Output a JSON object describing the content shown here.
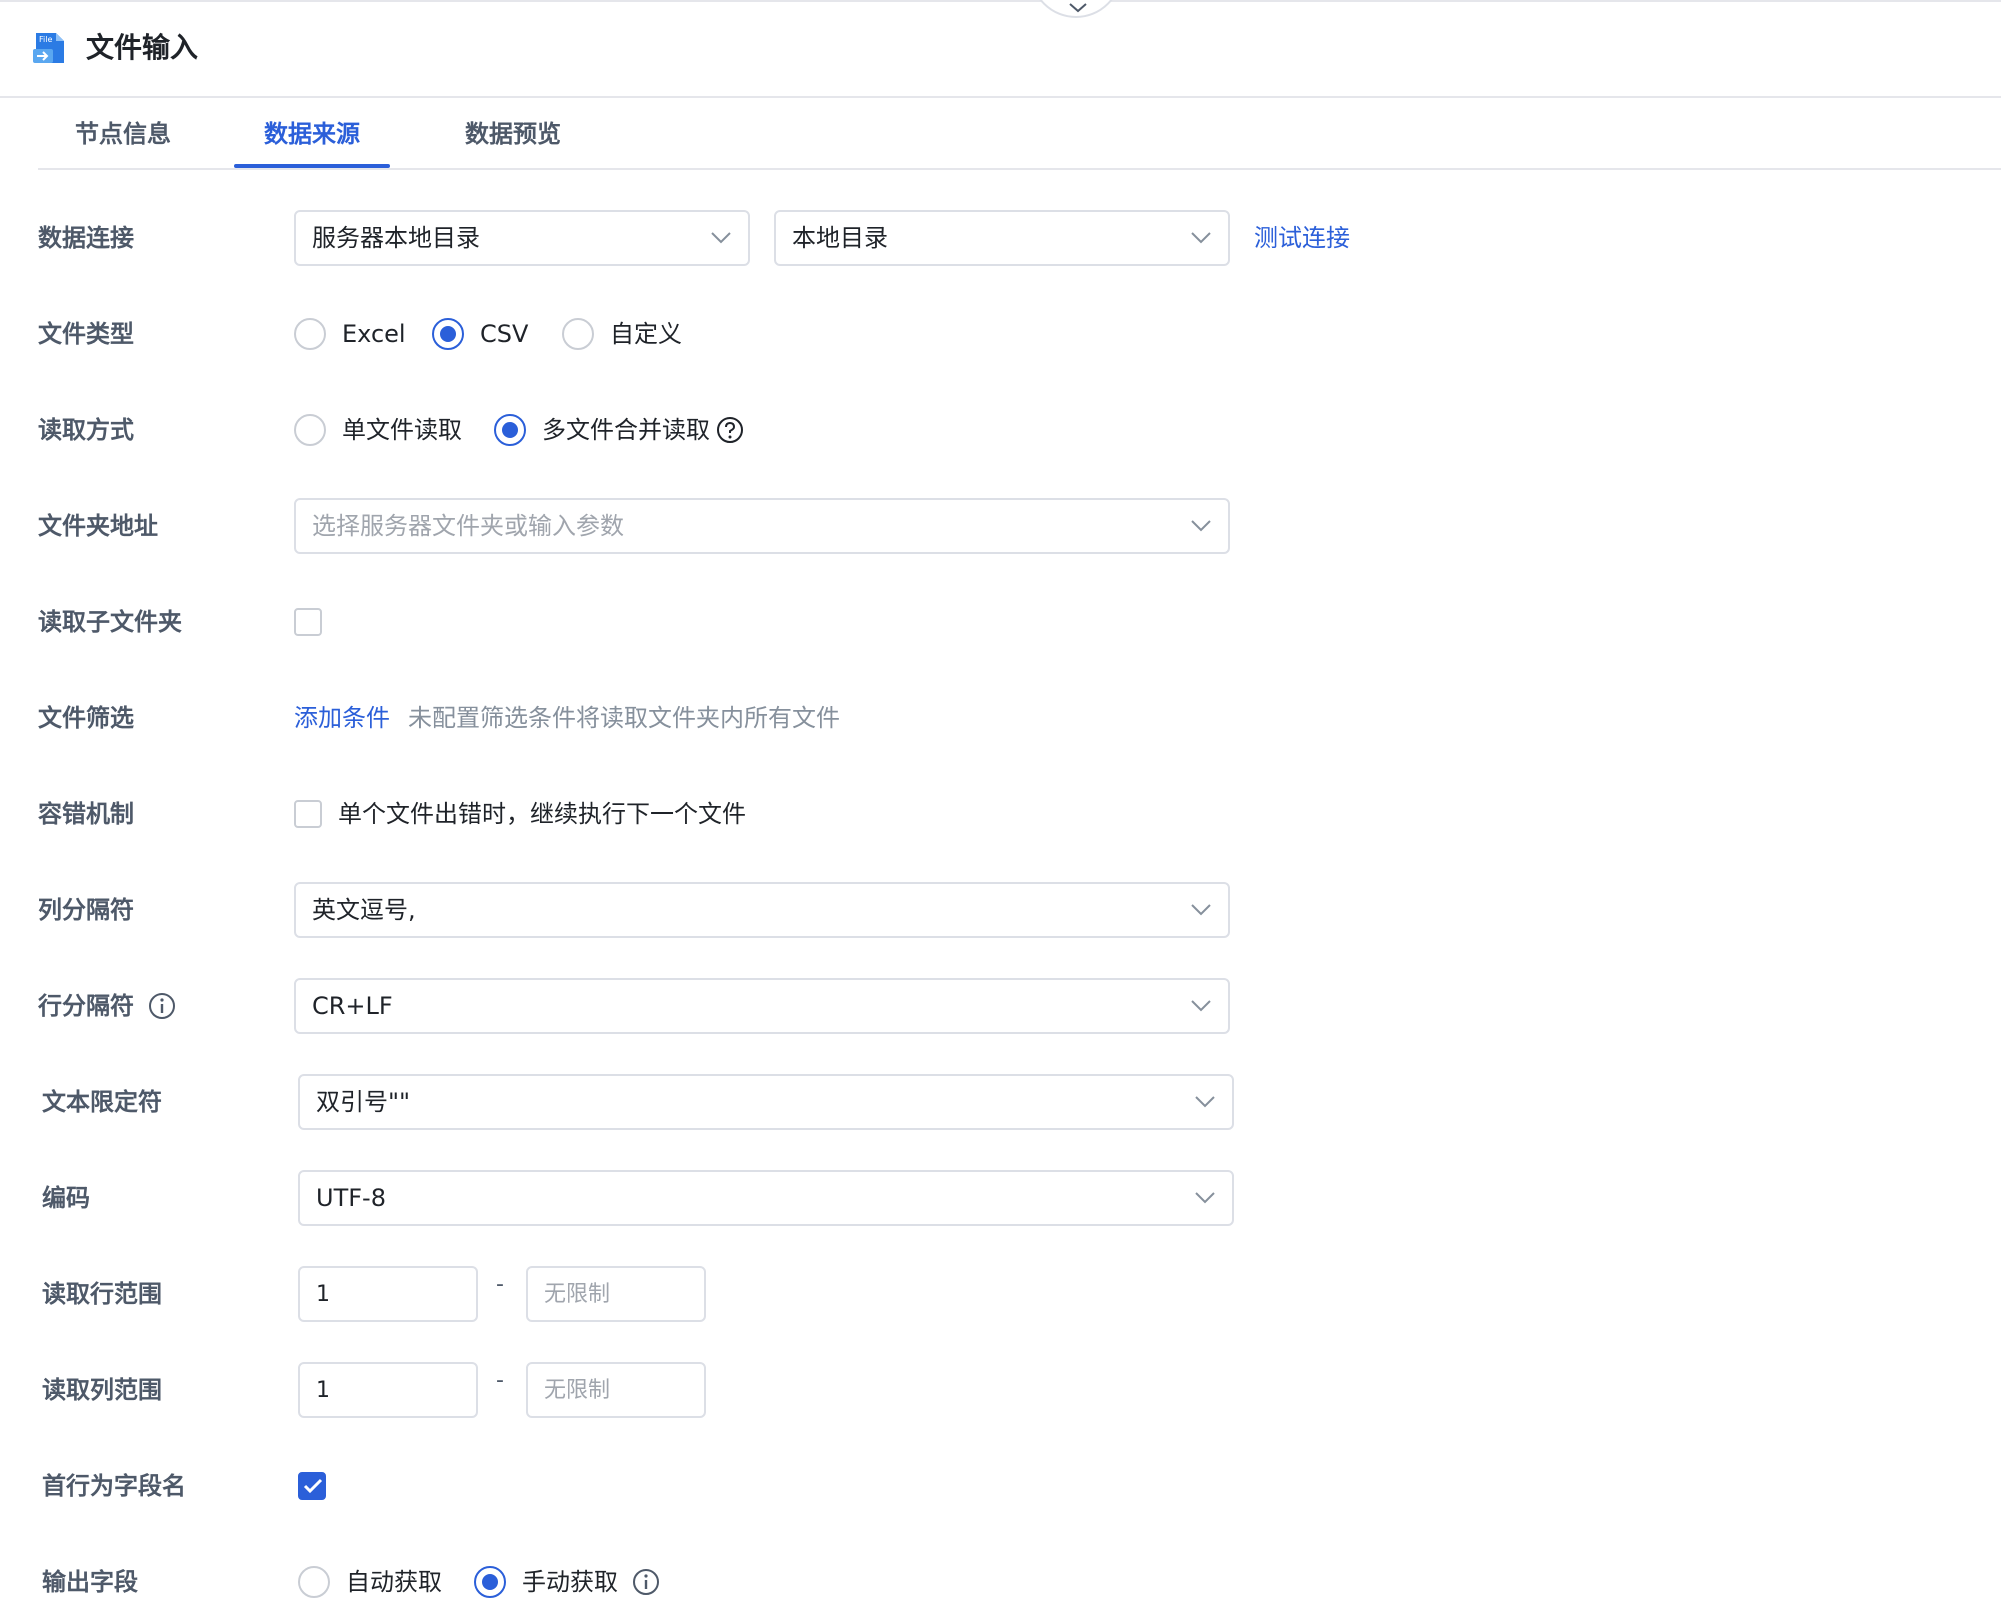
{
  "header": {
    "title": "文件输入",
    "icon": "file-input-icon",
    "icon_text": "File"
  },
  "tabs": [
    {
      "label": "节点信息",
      "active": false
    },
    {
      "label": "数据来源",
      "active": true
    },
    {
      "label": "数据预览",
      "active": false
    }
  ],
  "form": {
    "connection": {
      "label": "数据连接",
      "type_value": "服务器本地目录",
      "dir_value": "本地目录",
      "test_link": "测试连接"
    },
    "file_type": {
      "label": "文件类型",
      "options": [
        "Excel",
        "CSV",
        "自定义"
      ],
      "selected": "CSV"
    },
    "read_mode": {
      "label": "读取方式",
      "options": [
        "单文件读取",
        "多文件合并读取"
      ],
      "selected": "多文件合并读取",
      "help_icon": "question-circle-icon"
    },
    "folder_path": {
      "label": "文件夹地址",
      "placeholder": "选择服务器文件夹或输入参数"
    },
    "read_subfolders": {
      "label": "读取子文件夹",
      "checked": false
    },
    "file_filter": {
      "label": "文件筛选",
      "add_link": "添加条件",
      "hint": "未配置筛选条件将读取文件夹内所有文件"
    },
    "fault_tolerance": {
      "label": "容错机制",
      "checked": false,
      "option": "单个文件出错时，继续执行下一个文件"
    },
    "column_separator": {
      "label": "列分隔符",
      "value": "英文逗号,"
    },
    "row_separator": {
      "label": "行分隔符",
      "value": "CR+LF",
      "info_icon": "info-circle-icon"
    },
    "text_qualifier": {
      "label": "文本限定符",
      "value": "双引号\"\""
    },
    "encoding": {
      "label": "编码",
      "value": "UTF-8"
    },
    "row_range": {
      "label": "读取行范围",
      "start": "1",
      "dash": "-",
      "end_placeholder": "无限制"
    },
    "col_range": {
      "label": "读取列范围",
      "start": "1",
      "dash": "-",
      "end_placeholder": "无限制"
    },
    "header_row": {
      "label": "首行为字段名",
      "checked": true
    },
    "output_fields": {
      "label": "输出字段",
      "options": [
        "自动获取",
        "手动获取"
      ],
      "selected": "手动获取",
      "info_icon": "info-circle-icon"
    }
  },
  "colors": {
    "primary": "#2b5fd9",
    "label": "#4e5969",
    "border": "#dcdfe6",
    "placeholder": "#a0a5ad"
  }
}
